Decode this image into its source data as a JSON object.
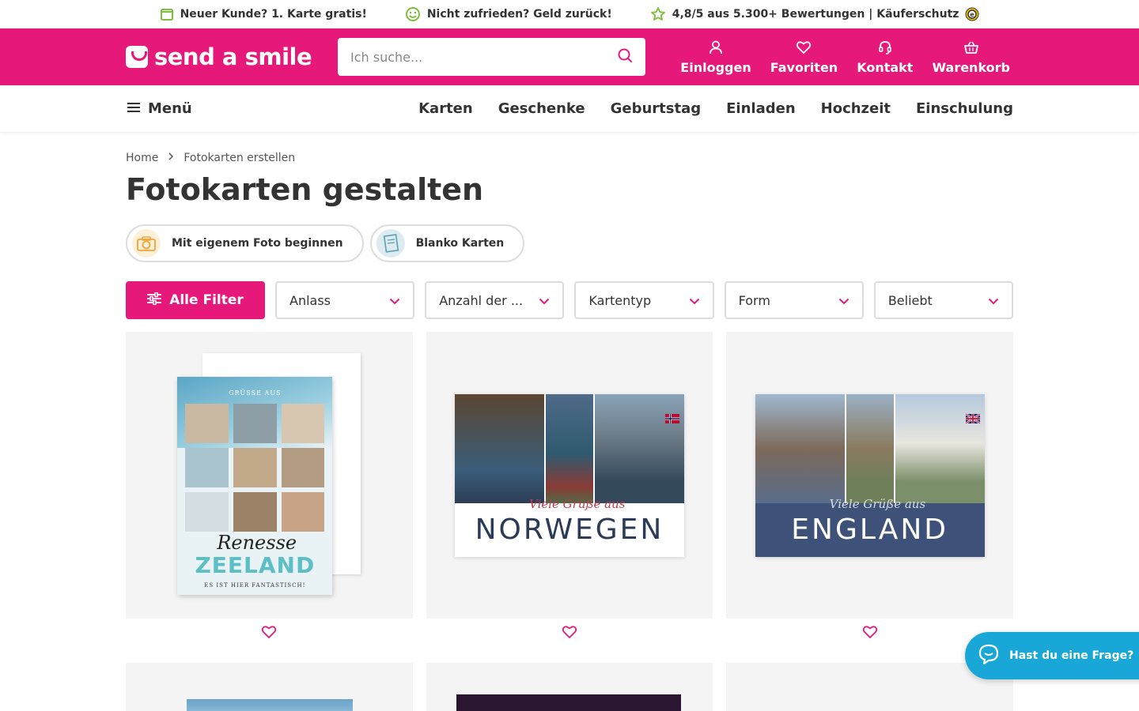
{
  "usp": {
    "item1": "Neuer Kunde? 1. Karte gratis!",
    "item2": "Nicht zufrieden? Geld zurück!",
    "item3": "4,8/5 aus 5.300+ Bewertungen | Käuferschutz"
  },
  "header": {
    "logo": "send a smile",
    "search_placeholder": "Ich suche...",
    "login": "Einloggen",
    "favorites": "Favoriten",
    "contact": "Kontakt",
    "cart": "Warenkorb"
  },
  "nav": {
    "menu": "Menü",
    "links": [
      "Karten",
      "Geschenke",
      "Geburtstag",
      "Einladen",
      "Hochzeit",
      "Einschulung"
    ]
  },
  "breadcrumb": {
    "home": "Home",
    "current": "Fotokarten erstellen"
  },
  "page_title": "Fotokarten gestalten",
  "chips": {
    "own_photo": "Mit eigenem Foto beginnen",
    "blank": "Blanko Karten"
  },
  "filters": {
    "all": "Alle Filter",
    "occasion": "Anlass",
    "count": "Anzahl der ...",
    "card_type": "Kartentyp",
    "shape": "Form",
    "sort": "Beliebt"
  },
  "cards": [
    {
      "tag": "GRÜSSE AUS",
      "script": "Renesse",
      "word": "ZEELAND",
      "sub": "ES IST HIER FANTASTISCH!"
    },
    {
      "script": "Viele Grüße aus",
      "word": "NORWEGEN"
    },
    {
      "script": "Viele Grüße aus",
      "word": "ENGLAND"
    }
  ],
  "chat": {
    "label": "Hast du eine Frage?"
  },
  "colors": {
    "brand": "#e6197b",
    "chat": "#19a7d8"
  }
}
